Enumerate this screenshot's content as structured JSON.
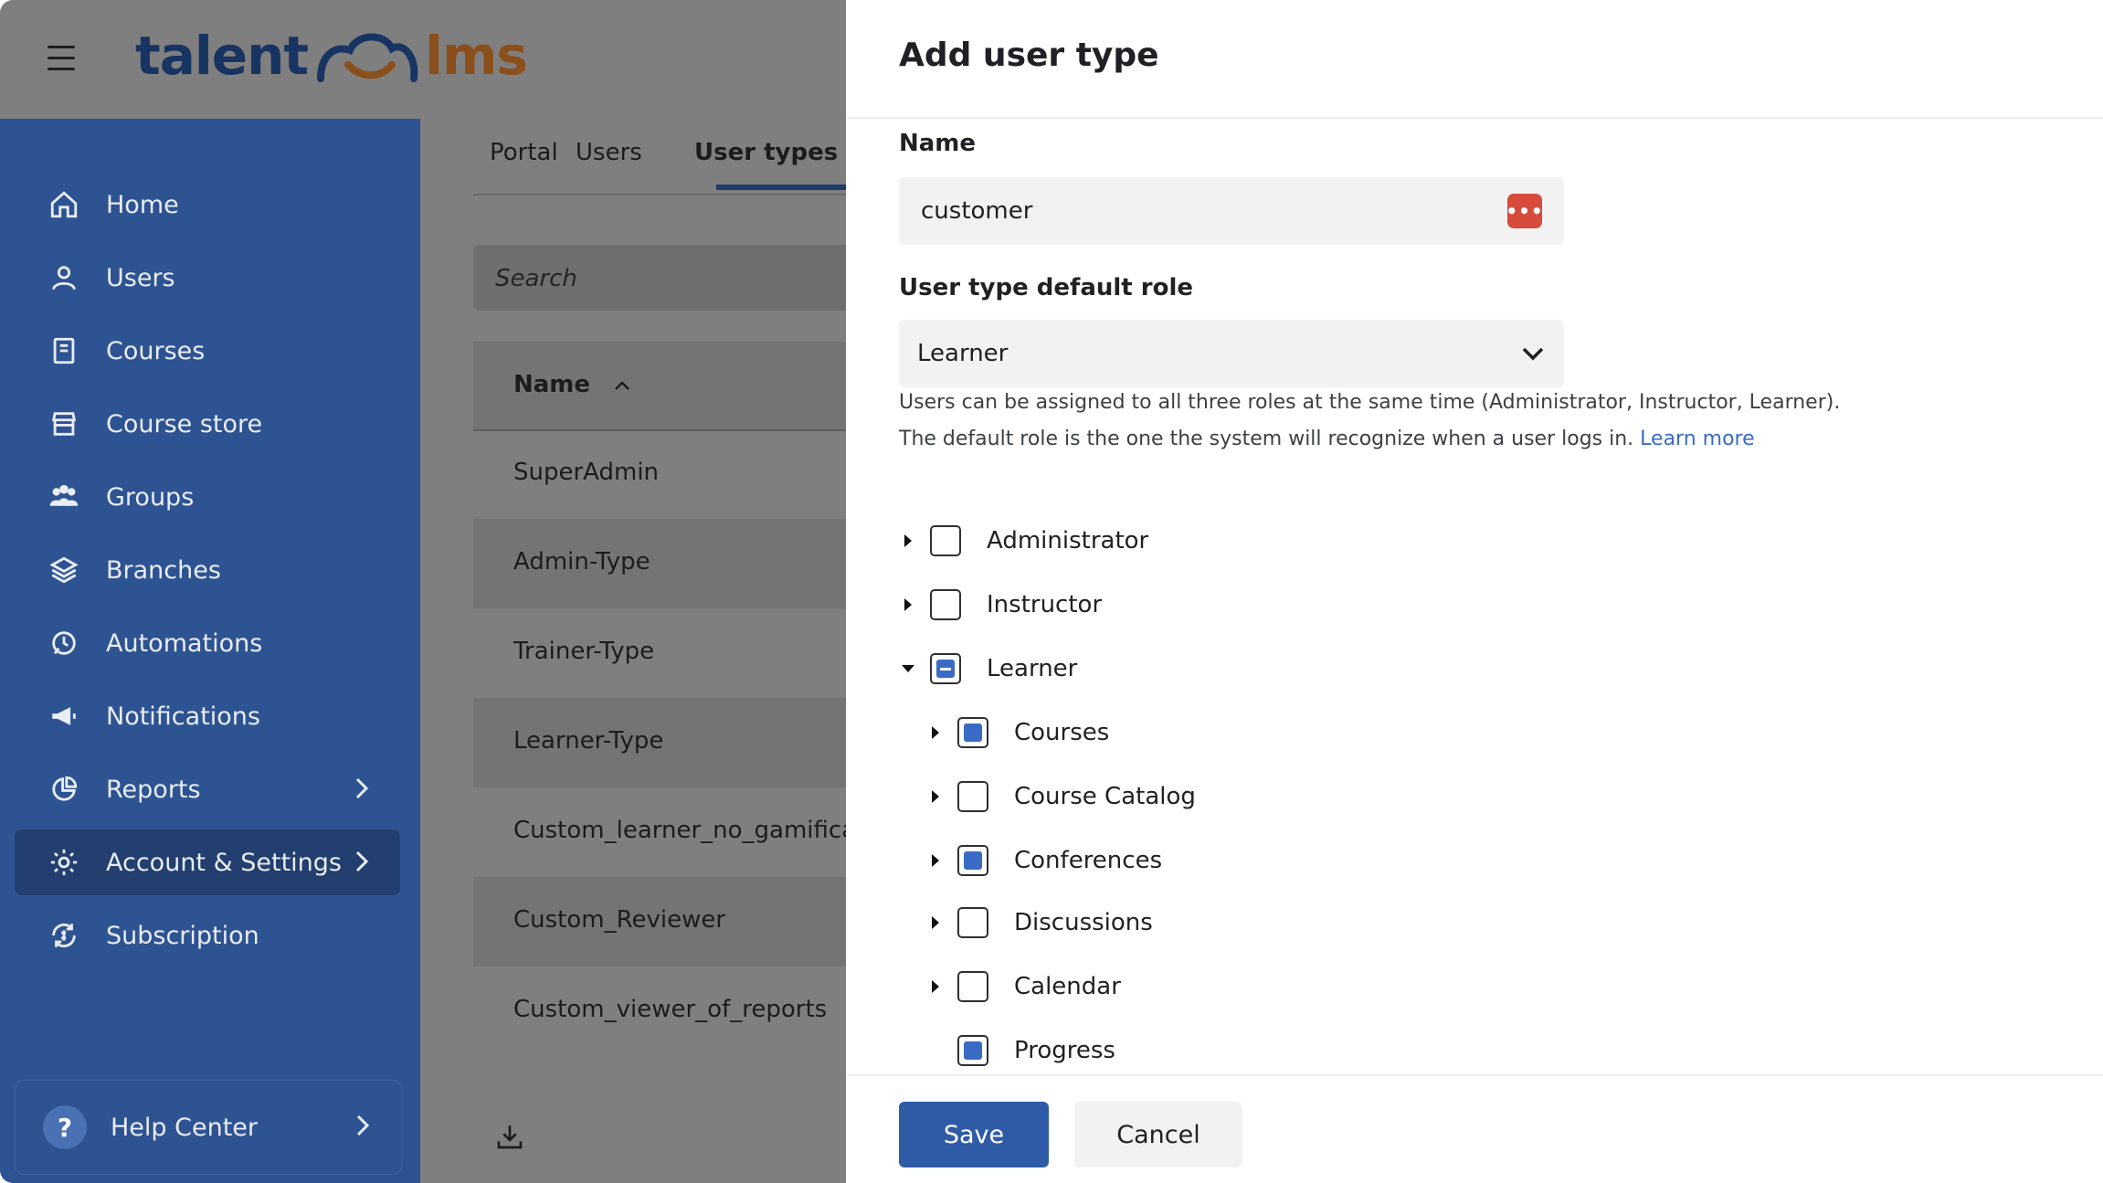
{
  "header": {
    "logo_part1": "talent",
    "logo_part2": "lms"
  },
  "sidebar": {
    "items": [
      {
        "label": "Home",
        "icon": "home-icon"
      },
      {
        "label": "Users",
        "icon": "user-icon"
      },
      {
        "label": "Courses",
        "icon": "book-icon"
      },
      {
        "label": "Course store",
        "icon": "store-icon"
      },
      {
        "label": "Groups",
        "icon": "groups-icon"
      },
      {
        "label": "Branches",
        "icon": "layers-icon"
      },
      {
        "label": "Automations",
        "icon": "automation-icon"
      },
      {
        "label": "Notifications",
        "icon": "megaphone-icon"
      },
      {
        "label": "Reports",
        "icon": "pie-chart-icon"
      },
      {
        "label": "Account & Settings",
        "icon": "gear-icon"
      },
      {
        "label": "Subscription",
        "icon": "subscription-icon"
      }
    ],
    "active": "Account & Settings",
    "help": "Help Center"
  },
  "main": {
    "tabs": [
      "Portal",
      "Users",
      "User types"
    ],
    "search_placeholder": "Search",
    "column_header": "Name",
    "rows": [
      "SuperAdmin",
      "Admin-Type",
      "Trainer-Type",
      "Learner-Type",
      "Custom_learner_no_gamifica...",
      "Custom_Reviewer",
      "Custom_viewer_of_reports"
    ]
  },
  "modal": {
    "title": "Add user type",
    "name_label": "Name",
    "name_value": "customer",
    "role_label": "User type default role",
    "role_value": "Learner",
    "help_line1": "Users can be assigned to all three roles at the same time (Administrator, Instructor, Learner).",
    "help_line2": "The default role is the one the system will recognize when a user logs in.",
    "learn_more": "Learn more",
    "tree": [
      {
        "label": "Administrator",
        "state": "unchecked",
        "expanded": false
      },
      {
        "label": "Instructor",
        "state": "unchecked",
        "expanded": false
      },
      {
        "label": "Learner",
        "state": "partial",
        "expanded": true
      },
      {
        "label": "Courses",
        "state": "checked"
      },
      {
        "label": "Course Catalog",
        "state": "unchecked"
      },
      {
        "label": "Conferences",
        "state": "checked"
      },
      {
        "label": "Discussions",
        "state": "unchecked"
      },
      {
        "label": "Calendar",
        "state": "unchecked"
      },
      {
        "label": "Progress",
        "state": "checked"
      }
    ],
    "save": "Save",
    "cancel": "Cancel"
  },
  "colors": {
    "accent": "#2f5ba6",
    "sidebar": "#2d5392",
    "link": "#3a6bc4",
    "logo_dark": "#173462",
    "logo_orange": "#8a4f1b"
  }
}
